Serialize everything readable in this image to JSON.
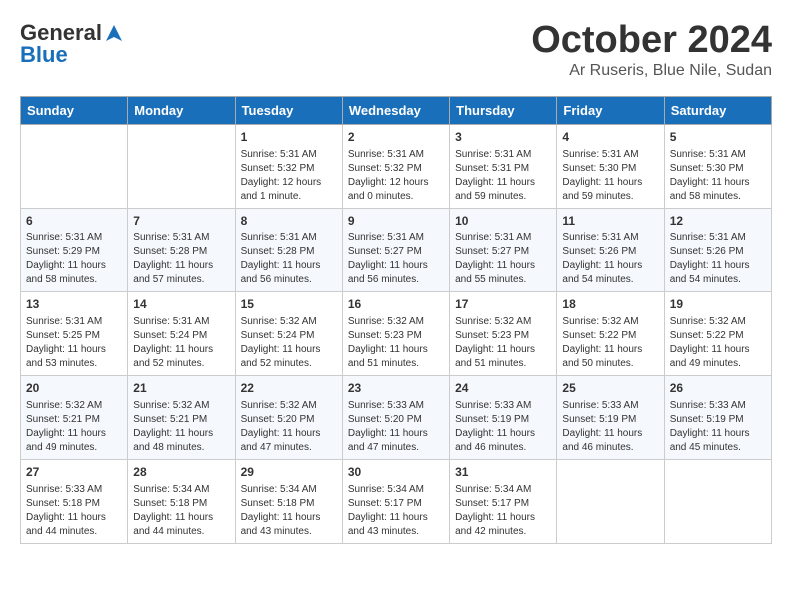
{
  "logo": {
    "general": "General",
    "blue": "Blue"
  },
  "title": "October 2024",
  "subtitle": "Ar Ruseris, Blue Nile, Sudan",
  "days_of_week": [
    "Sunday",
    "Monday",
    "Tuesday",
    "Wednesday",
    "Thursday",
    "Friday",
    "Saturday"
  ],
  "weeks": [
    [
      {
        "day": "",
        "info": ""
      },
      {
        "day": "",
        "info": ""
      },
      {
        "day": "1",
        "info": "Sunrise: 5:31 AM\nSunset: 5:32 PM\nDaylight: 12 hours\nand 1 minute."
      },
      {
        "day": "2",
        "info": "Sunrise: 5:31 AM\nSunset: 5:32 PM\nDaylight: 12 hours\nand 0 minutes."
      },
      {
        "day": "3",
        "info": "Sunrise: 5:31 AM\nSunset: 5:31 PM\nDaylight: 11 hours\nand 59 minutes."
      },
      {
        "day": "4",
        "info": "Sunrise: 5:31 AM\nSunset: 5:30 PM\nDaylight: 11 hours\nand 59 minutes."
      },
      {
        "day": "5",
        "info": "Sunrise: 5:31 AM\nSunset: 5:30 PM\nDaylight: 11 hours\nand 58 minutes."
      }
    ],
    [
      {
        "day": "6",
        "info": "Sunrise: 5:31 AM\nSunset: 5:29 PM\nDaylight: 11 hours\nand 58 minutes."
      },
      {
        "day": "7",
        "info": "Sunrise: 5:31 AM\nSunset: 5:28 PM\nDaylight: 11 hours\nand 57 minutes."
      },
      {
        "day": "8",
        "info": "Sunrise: 5:31 AM\nSunset: 5:28 PM\nDaylight: 11 hours\nand 56 minutes."
      },
      {
        "day": "9",
        "info": "Sunrise: 5:31 AM\nSunset: 5:27 PM\nDaylight: 11 hours\nand 56 minutes."
      },
      {
        "day": "10",
        "info": "Sunrise: 5:31 AM\nSunset: 5:27 PM\nDaylight: 11 hours\nand 55 minutes."
      },
      {
        "day": "11",
        "info": "Sunrise: 5:31 AM\nSunset: 5:26 PM\nDaylight: 11 hours\nand 54 minutes."
      },
      {
        "day": "12",
        "info": "Sunrise: 5:31 AM\nSunset: 5:26 PM\nDaylight: 11 hours\nand 54 minutes."
      }
    ],
    [
      {
        "day": "13",
        "info": "Sunrise: 5:31 AM\nSunset: 5:25 PM\nDaylight: 11 hours\nand 53 minutes."
      },
      {
        "day": "14",
        "info": "Sunrise: 5:31 AM\nSunset: 5:24 PM\nDaylight: 11 hours\nand 52 minutes."
      },
      {
        "day": "15",
        "info": "Sunrise: 5:32 AM\nSunset: 5:24 PM\nDaylight: 11 hours\nand 52 minutes."
      },
      {
        "day": "16",
        "info": "Sunrise: 5:32 AM\nSunset: 5:23 PM\nDaylight: 11 hours\nand 51 minutes."
      },
      {
        "day": "17",
        "info": "Sunrise: 5:32 AM\nSunset: 5:23 PM\nDaylight: 11 hours\nand 51 minutes."
      },
      {
        "day": "18",
        "info": "Sunrise: 5:32 AM\nSunset: 5:22 PM\nDaylight: 11 hours\nand 50 minutes."
      },
      {
        "day": "19",
        "info": "Sunrise: 5:32 AM\nSunset: 5:22 PM\nDaylight: 11 hours\nand 49 minutes."
      }
    ],
    [
      {
        "day": "20",
        "info": "Sunrise: 5:32 AM\nSunset: 5:21 PM\nDaylight: 11 hours\nand 49 minutes."
      },
      {
        "day": "21",
        "info": "Sunrise: 5:32 AM\nSunset: 5:21 PM\nDaylight: 11 hours\nand 48 minutes."
      },
      {
        "day": "22",
        "info": "Sunrise: 5:32 AM\nSunset: 5:20 PM\nDaylight: 11 hours\nand 47 minutes."
      },
      {
        "day": "23",
        "info": "Sunrise: 5:33 AM\nSunset: 5:20 PM\nDaylight: 11 hours\nand 47 minutes."
      },
      {
        "day": "24",
        "info": "Sunrise: 5:33 AM\nSunset: 5:19 PM\nDaylight: 11 hours\nand 46 minutes."
      },
      {
        "day": "25",
        "info": "Sunrise: 5:33 AM\nSunset: 5:19 PM\nDaylight: 11 hours\nand 46 minutes."
      },
      {
        "day": "26",
        "info": "Sunrise: 5:33 AM\nSunset: 5:19 PM\nDaylight: 11 hours\nand 45 minutes."
      }
    ],
    [
      {
        "day": "27",
        "info": "Sunrise: 5:33 AM\nSunset: 5:18 PM\nDaylight: 11 hours\nand 44 minutes."
      },
      {
        "day": "28",
        "info": "Sunrise: 5:34 AM\nSunset: 5:18 PM\nDaylight: 11 hours\nand 44 minutes."
      },
      {
        "day": "29",
        "info": "Sunrise: 5:34 AM\nSunset: 5:18 PM\nDaylight: 11 hours\nand 43 minutes."
      },
      {
        "day": "30",
        "info": "Sunrise: 5:34 AM\nSunset: 5:17 PM\nDaylight: 11 hours\nand 43 minutes."
      },
      {
        "day": "31",
        "info": "Sunrise: 5:34 AM\nSunset: 5:17 PM\nDaylight: 11 hours\nand 42 minutes."
      },
      {
        "day": "",
        "info": ""
      },
      {
        "day": "",
        "info": ""
      }
    ]
  ]
}
